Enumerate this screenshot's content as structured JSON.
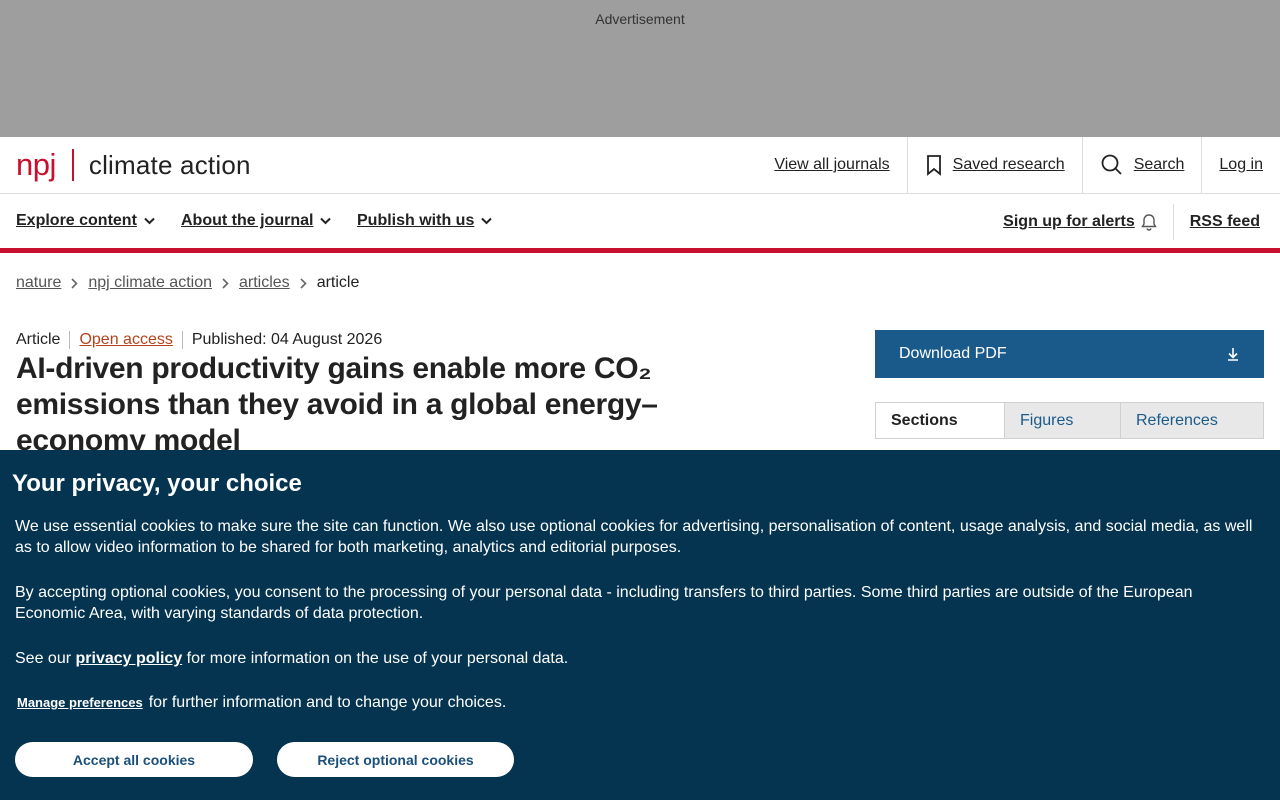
{
  "ad": {
    "label": "Advertisement"
  },
  "header": {
    "logo_npj": "npj",
    "logo_name": "climate action",
    "links": {
      "view_all": "View all journals",
      "saved": "Saved research",
      "search": "Search",
      "login": "Log in"
    }
  },
  "nav": {
    "explore": "Explore content",
    "about": "About the journal",
    "publish": "Publish with us",
    "alerts": "Sign up for alerts",
    "rss": "RSS feed"
  },
  "breadcrumb": [
    "nature",
    "npj climate action",
    "articles",
    "article"
  ],
  "article": {
    "type": "Article",
    "access": "Open access",
    "published": "Published: 04 August 2026",
    "title": "AI-driven productivity gains enable more CO₂ emissions than they avoid in a global energy–economy model"
  },
  "sidebar": {
    "download": "Download PDF",
    "tabs": [
      "Sections",
      "Figures",
      "References"
    ]
  },
  "cookie": {
    "title": "Your privacy, your choice",
    "p1": "We use essential cookies to make sure the site can function. We also use optional cookies for advertising, personalisation of content, usage analysis, and social media, as well as to allow video information to be shared for both marketing, analytics and editorial purposes.",
    "p2": "By accepting optional cookies, you consent to the processing of your personal data - including transfers to third parties. Some third parties are outside of the European Economic Area, with varying standards of data protection.",
    "p3_before": "See our",
    "p3_link": "privacy policy",
    "p3_after": "for more information on the use of your personal data.",
    "manage": "Manage preferences",
    "manage_after": "for further information and to change your choices.",
    "accept": "Accept all cookies",
    "reject": "Reject optional cookies"
  },
  "colors": {
    "brand_red": "#c8102e",
    "link_blue": "#1a5a8a",
    "cookie_bg": "#04344f"
  }
}
